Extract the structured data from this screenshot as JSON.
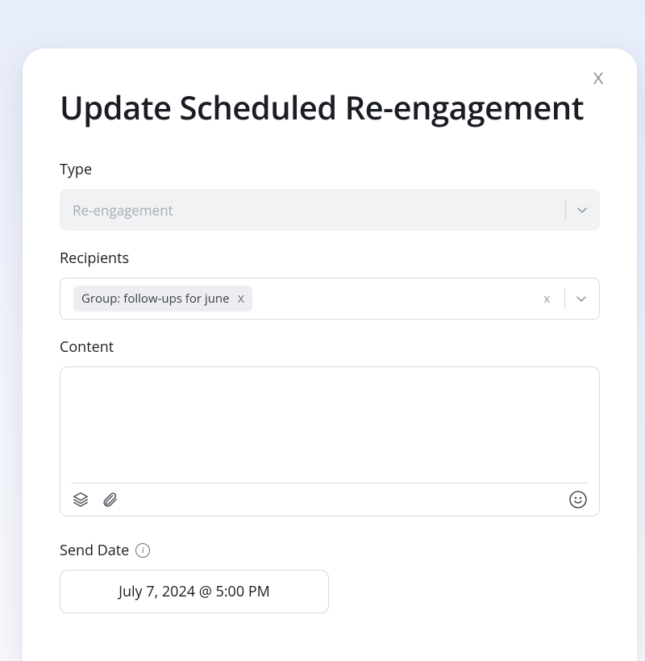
{
  "modal": {
    "title": "Update Scheduled Re-engagement"
  },
  "type": {
    "label": "Type",
    "value": "Re-engagement"
  },
  "recipients": {
    "label": "Recipients",
    "tags": [
      {
        "text": "Group: follow-ups for june"
      }
    ]
  },
  "content": {
    "label": "Content",
    "value": ""
  },
  "sendDate": {
    "label": "Send Date",
    "value": "July 7, 2024 @ 5:00 PM"
  }
}
